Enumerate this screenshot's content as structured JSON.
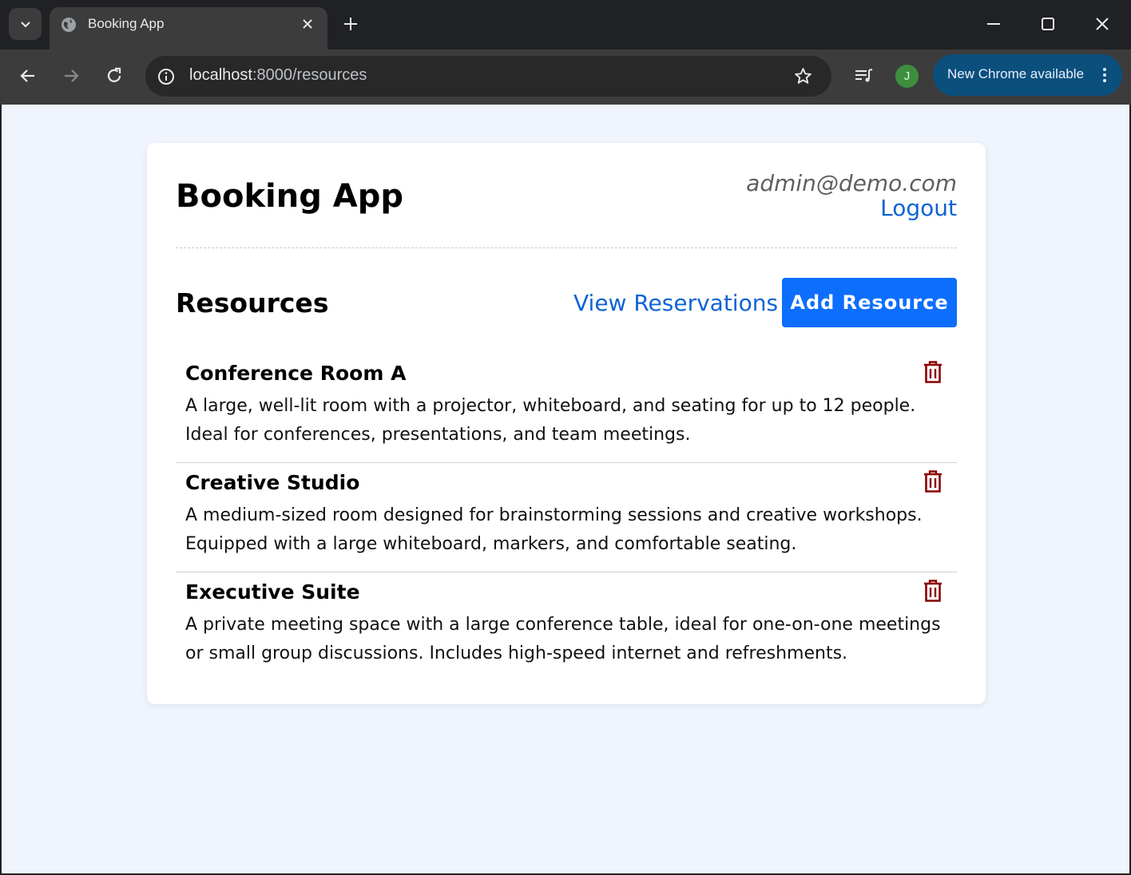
{
  "browser": {
    "tab_title": "Booking App",
    "url_host": "localhost",
    "url_path": ":8000/resources",
    "profile_initial": "J",
    "update_label": "New Chrome available"
  },
  "header": {
    "app_title": "Booking App",
    "user_email": "admin@demo.com",
    "logout_label": "Logout"
  },
  "resources_section": {
    "title": "Resources",
    "view_reservations_label": "View Reservations",
    "add_resource_label": "Add Resource"
  },
  "resources": [
    {
      "name": "Conference Room A",
      "description": "A large, well-lit room with a projector, whiteboard, and seating for up to 12 people. Ideal for conferences, presentations, and team meetings."
    },
    {
      "name": "Creative Studio",
      "description": "A medium-sized room designed for brainstorming sessions and creative workshops. Equipped with a large whiteboard, markers, and comfortable seating."
    },
    {
      "name": "Executive Suite",
      "description": "A private meeting space with a large conference table, ideal for one-on-one meetings or small group discussions. Includes high-speed internet and refreshments."
    }
  ],
  "colors": {
    "accent": "#0d6efd",
    "link": "#0d63d6",
    "delete": "#8b0000",
    "page_bg": "#f0f4fc"
  },
  "icons": {
    "delete": "trash-icon"
  }
}
